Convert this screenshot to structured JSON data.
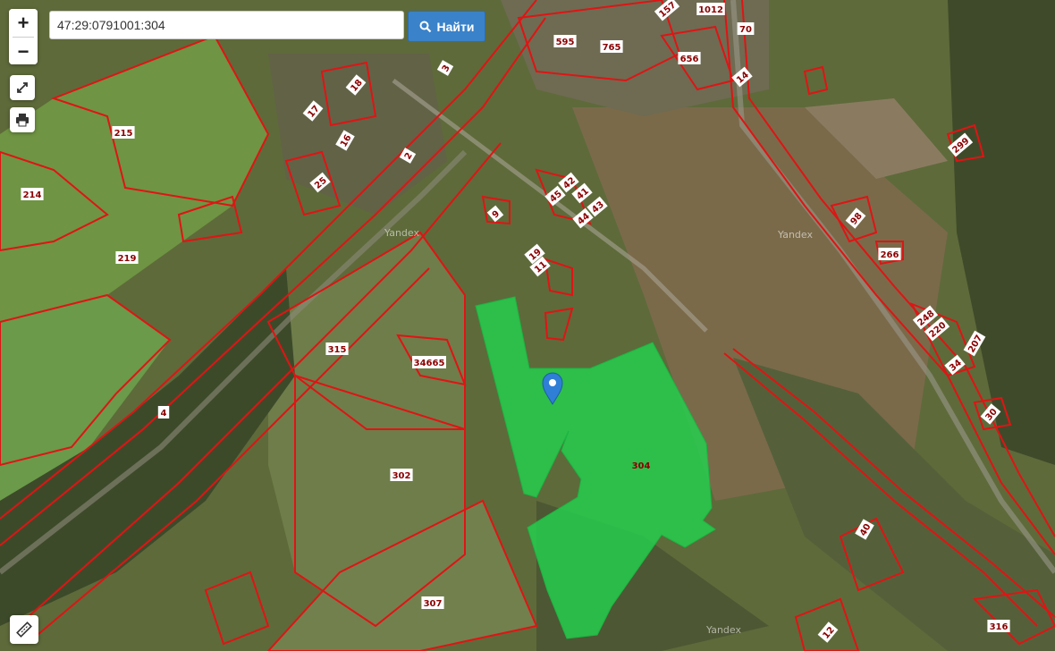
{
  "search": {
    "value": "47:29:0791001:304",
    "button_label": "Найти"
  },
  "zoom": {
    "in_label": "+",
    "out_label": "−"
  },
  "watermark": "Yandex",
  "parcel_labels": [
    "157",
    "1012",
    "595",
    "765",
    "70",
    "656",
    "14",
    "3",
    "18",
    "17",
    "16",
    "215",
    "2",
    "299",
    "214",
    "25",
    "42",
    "41",
    "45",
    "43",
    "9",
    "44",
    "98",
    "219",
    "266",
    "19",
    "11",
    "248",
    "220",
    "207",
    "315",
    "34665",
    "34",
    "30",
    "4",
    "304",
    "302",
    "40",
    "307",
    "12",
    "316"
  ],
  "colors": {
    "boundary": "#e01414",
    "selected_parcel": "#22d24e",
    "button": "#3a82c9",
    "marker": "#2f7fd6"
  }
}
